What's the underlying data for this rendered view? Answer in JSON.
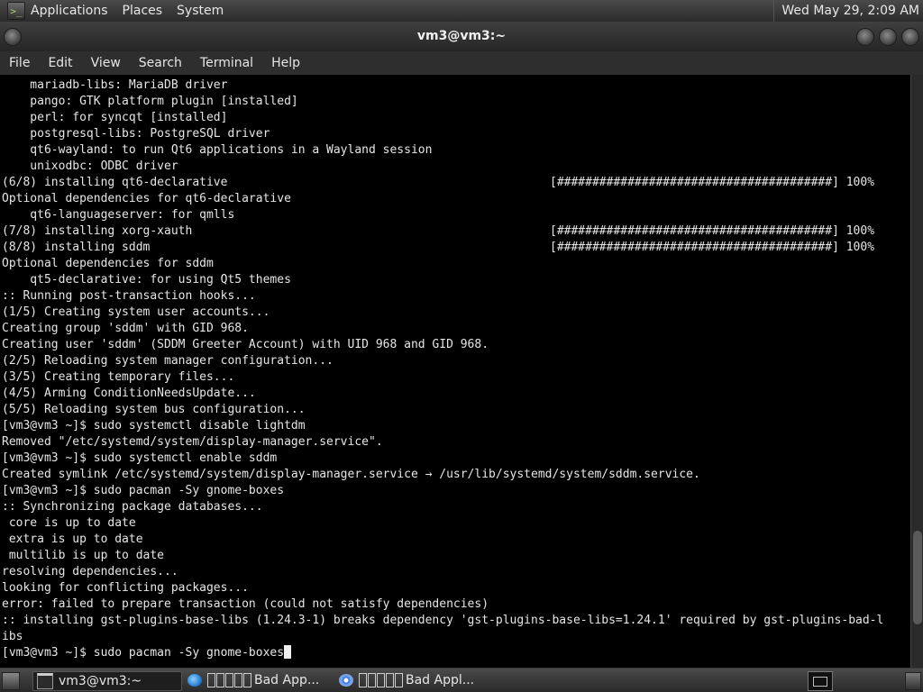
{
  "top_panel": {
    "menus": [
      "Applications",
      "Places",
      "System"
    ],
    "clock": "Wed May 29,  2:09 AM"
  },
  "window": {
    "title": "vm3@vm3:~",
    "menu": [
      "File",
      "Edit",
      "View",
      "Search",
      "Terminal",
      "Help"
    ]
  },
  "terminal": {
    "lines": [
      {
        "text": "    mariadb-libs: MariaDB driver"
      },
      {
        "text": "    pango: GTK platform plugin [installed]"
      },
      {
        "text": "    perl: for syncqt [installed]"
      },
      {
        "text": "    postgresql-libs: PostgreSQL driver"
      },
      {
        "text": "    qt6-wayland: to run Qt6 applications in a Wayland session"
      },
      {
        "text": "    unixodbc: ODBC driver"
      },
      {
        "text": "(6/8) installing qt6-declarative",
        "bar": "[#######################################] 100%"
      },
      {
        "text": "Optional dependencies for qt6-declarative"
      },
      {
        "text": "    qt6-languageserver: for qmlls"
      },
      {
        "text": "(7/8) installing xorg-xauth",
        "bar": "[#######################################] 100%"
      },
      {
        "text": "(8/8) installing sddm",
        "bar": "[#######################################] 100%"
      },
      {
        "text": "Optional dependencies for sddm"
      },
      {
        "text": "    qt5-declarative: for using Qt5 themes"
      },
      {
        "text": ":: Running post-transaction hooks..."
      },
      {
        "text": "(1/5) Creating system user accounts..."
      },
      {
        "text": "Creating group 'sddm' with GID 968."
      },
      {
        "text": "Creating user 'sddm' (SDDM Greeter Account) with UID 968 and GID 968."
      },
      {
        "text": "(2/5) Reloading system manager configuration..."
      },
      {
        "text": "(3/5) Creating temporary files..."
      },
      {
        "text": "(4/5) Arming ConditionNeedsUpdate..."
      },
      {
        "text": "(5/5) Reloading system bus configuration..."
      },
      {
        "text": "[vm3@vm3 ~]$ sudo systemctl disable lightdm"
      },
      {
        "text": "Removed \"/etc/systemd/system/display-manager.service\"."
      },
      {
        "text": "[vm3@vm3 ~]$ sudo systemctl enable sddm"
      },
      {
        "text": "Created symlink /etc/systemd/system/display-manager.service → /usr/lib/systemd/system/sddm.service."
      },
      {
        "text": "[vm3@vm3 ~]$ sudo pacman -Sy gnome-boxes"
      },
      {
        "text": ":: Synchronizing package databases..."
      },
      {
        "text": " core is up to date"
      },
      {
        "text": " extra is up to date"
      },
      {
        "text": " multilib is up to date"
      },
      {
        "text": "resolving dependencies..."
      },
      {
        "text": "looking for conflicting packages..."
      },
      {
        "text": "error: failed to prepare transaction (could not satisfy dependencies)"
      },
      {
        "text": ":: installing gst-plugins-base-libs (1.24.3-1) breaks dependency 'gst-plugins-base-libs=1.24.1' required by gst-plugins-bad-l"
      },
      {
        "text": "ibs"
      }
    ],
    "prompt": "[vm3@vm3 ~]$ sudo pacman -Sy gnome-boxes",
    "scroll_position": 0.92
  },
  "taskbar": {
    "tasks": [
      {
        "label": "vm3@vm3:~",
        "icon": "terminal-icon",
        "active": true
      },
      {
        "label": "Bad App...",
        "icon": "browser-icon",
        "active": false
      },
      {
        "label": "Bad Appl...",
        "icon": "chrome-icon",
        "active": false
      }
    ]
  }
}
